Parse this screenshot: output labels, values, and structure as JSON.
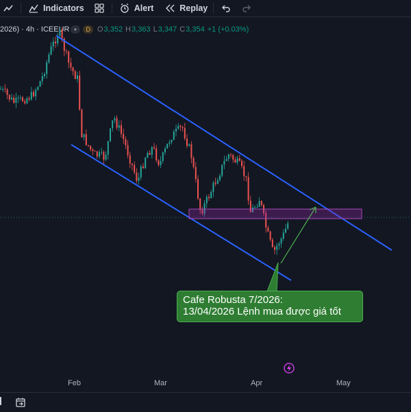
{
  "toolbar": {
    "indicators_label": "Indicators",
    "alert_label": "Alert",
    "replay_label": "Replay",
    "icons": [
      "indicators-icon",
      "layouts-icon",
      "alert-icon",
      "replay-icon",
      "undo-icon",
      "redo-icon"
    ]
  },
  "legend": {
    "symbol_text": "2026) · 4h · ICEEUR",
    "timeframe_badge": "D",
    "open_label": "O",
    "open_value": "3,352",
    "high_label": "H",
    "high_value": "3,363",
    "low_label": "L",
    "low_value": "3,347",
    "close_label": "C",
    "close_value": "3,354",
    "change": "+1 (+0.03%)",
    "up_color": "#089981"
  },
  "annotation": {
    "line1": "Cafe Robusta 7/2026:",
    "line2": "13/04/2026 Lệnh mua được giá tốt",
    "background": "#2e7d32"
  },
  "time_axis": {
    "labels": [
      "Feb",
      "Mar",
      "Apr",
      "May"
    ]
  },
  "colors": {
    "background": "#131722",
    "candle_up": "#26a69a",
    "candle_down": "#ef5350",
    "channel_line": "#2962ff",
    "zone_fill": "#9c27b0",
    "arrow": "#4caf50"
  }
}
